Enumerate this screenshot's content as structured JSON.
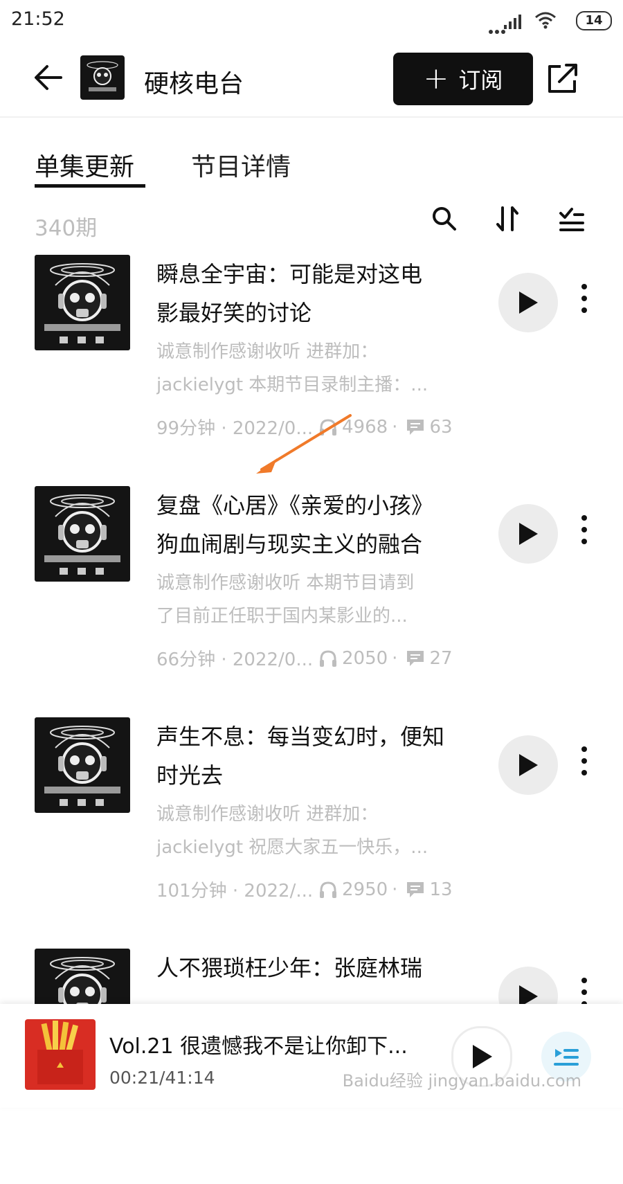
{
  "status_bar": {
    "time": "21:52",
    "battery": "14"
  },
  "header": {
    "title": "硬核电台",
    "subscribe_label": "订阅"
  },
  "tabs": [
    {
      "label": "单集更新"
    },
    {
      "label": "节目详情"
    }
  ],
  "list": {
    "count": "340期"
  },
  "episodes": [
    {
      "title_line1": "瞬息全宇宙：可能是对这电",
      "title_line2": "影最好笑的讨论",
      "desc_line1": "诚意制作感谢收听 进群加：",
      "desc_line2": "jackielygt 本期节目录制主播：...",
      "duration_date": "99分钟 · 2022/0...",
      "plays": "4968",
      "comments": "63"
    },
    {
      "title_line1": "复盘《心居》《亲爱的小孩》",
      "title_line2": "狗血闹剧与现实主义的融合",
      "desc_line1": "诚意制作感谢收听 本期节目请到",
      "desc_line2": "了目前正任职于国内某影业的...",
      "duration_date": "66分钟 · 2022/0...",
      "plays": "2050",
      "comments": "27"
    },
    {
      "title_line1": "声生不息：每当变幻时，便知",
      "title_line2": "时光去",
      "desc_line1": "诚意制作感谢收听 进群加：",
      "desc_line2": "jackielygt 祝愿大家五一快乐，...",
      "duration_date": "101分钟 · 2022/...",
      "plays": "2950",
      "comments": "13"
    },
    {
      "title_line1": "人不猥琐枉少年：张庭林瑞",
      "title_line2": "",
      "desc_line1": "",
      "desc_line2": "",
      "duration_date": "",
      "plays": "",
      "comments": ""
    }
  ],
  "now_playing": {
    "title": "Vol.21 很遗憾我不是让你卸下...",
    "time": "00:21/41:14"
  },
  "watermark": "Baidu经验 jingyan.baidu.com",
  "colors": {
    "accent_dark": "#101010",
    "muted_text": "#bdbdbd",
    "annotation_arrow": "#f07a2a"
  }
}
